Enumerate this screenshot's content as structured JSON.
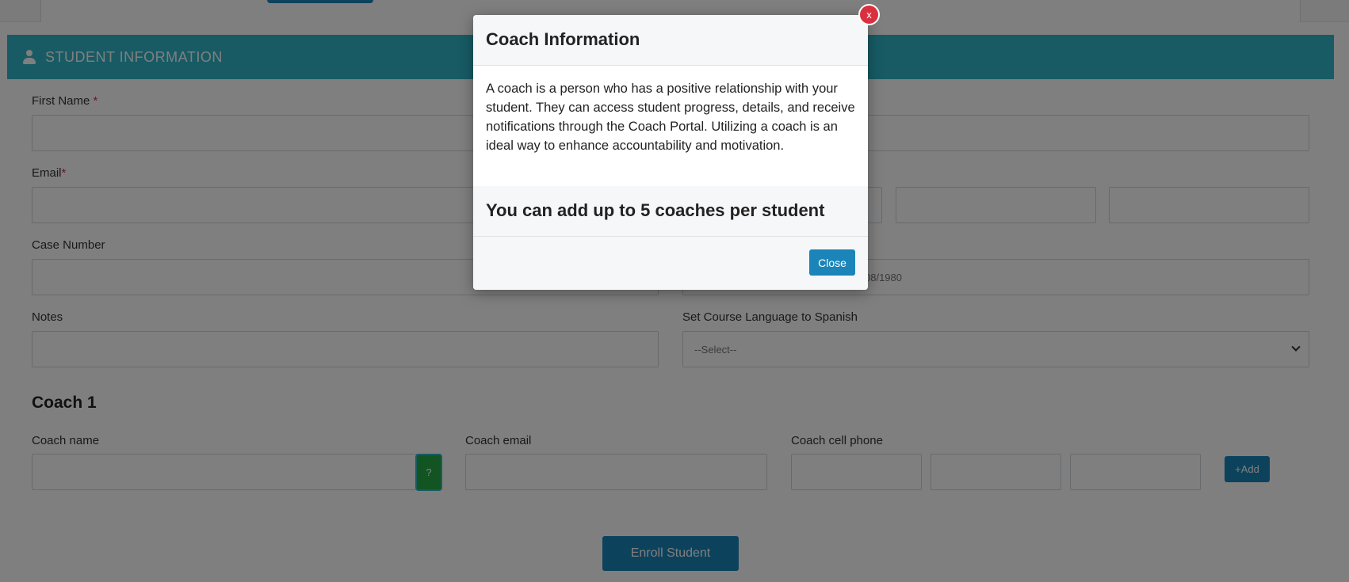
{
  "section": {
    "title": "STUDENT INFORMATION",
    "icon": "user-icon"
  },
  "form": {
    "first_name_label": "First Name",
    "email_label": "Email",
    "required_mark": "*",
    "case_number_label": "Case Number",
    "dob_placeholder_visible": "08/1980",
    "notes_label": "Notes",
    "spanish_label": "Set Course Language to Spanish",
    "spanish_selected": "--Select--"
  },
  "coach": {
    "heading": "Coach 1",
    "name_label": "Coach name",
    "email_label": "Coach email",
    "phone_label": "Coach cell phone",
    "help_label": "?",
    "add_label": "+Add"
  },
  "enroll_label": "Enroll Student",
  "modal": {
    "title": "Coach Information",
    "body": "A coach is a person who has a positive relationship with your student. They can access student progress, details, and receive notifications through the Coach Portal. Utilizing a coach is an ideal way to enhance accountability and motivation.",
    "limit_text": "You can add up to 5 coaches per student",
    "close_label": "Close",
    "x_label": "x"
  },
  "colors": {
    "accent": "#30b7c9",
    "primary_button": "#1b84b9",
    "danger": "#d9303f",
    "success": "#25a844"
  }
}
